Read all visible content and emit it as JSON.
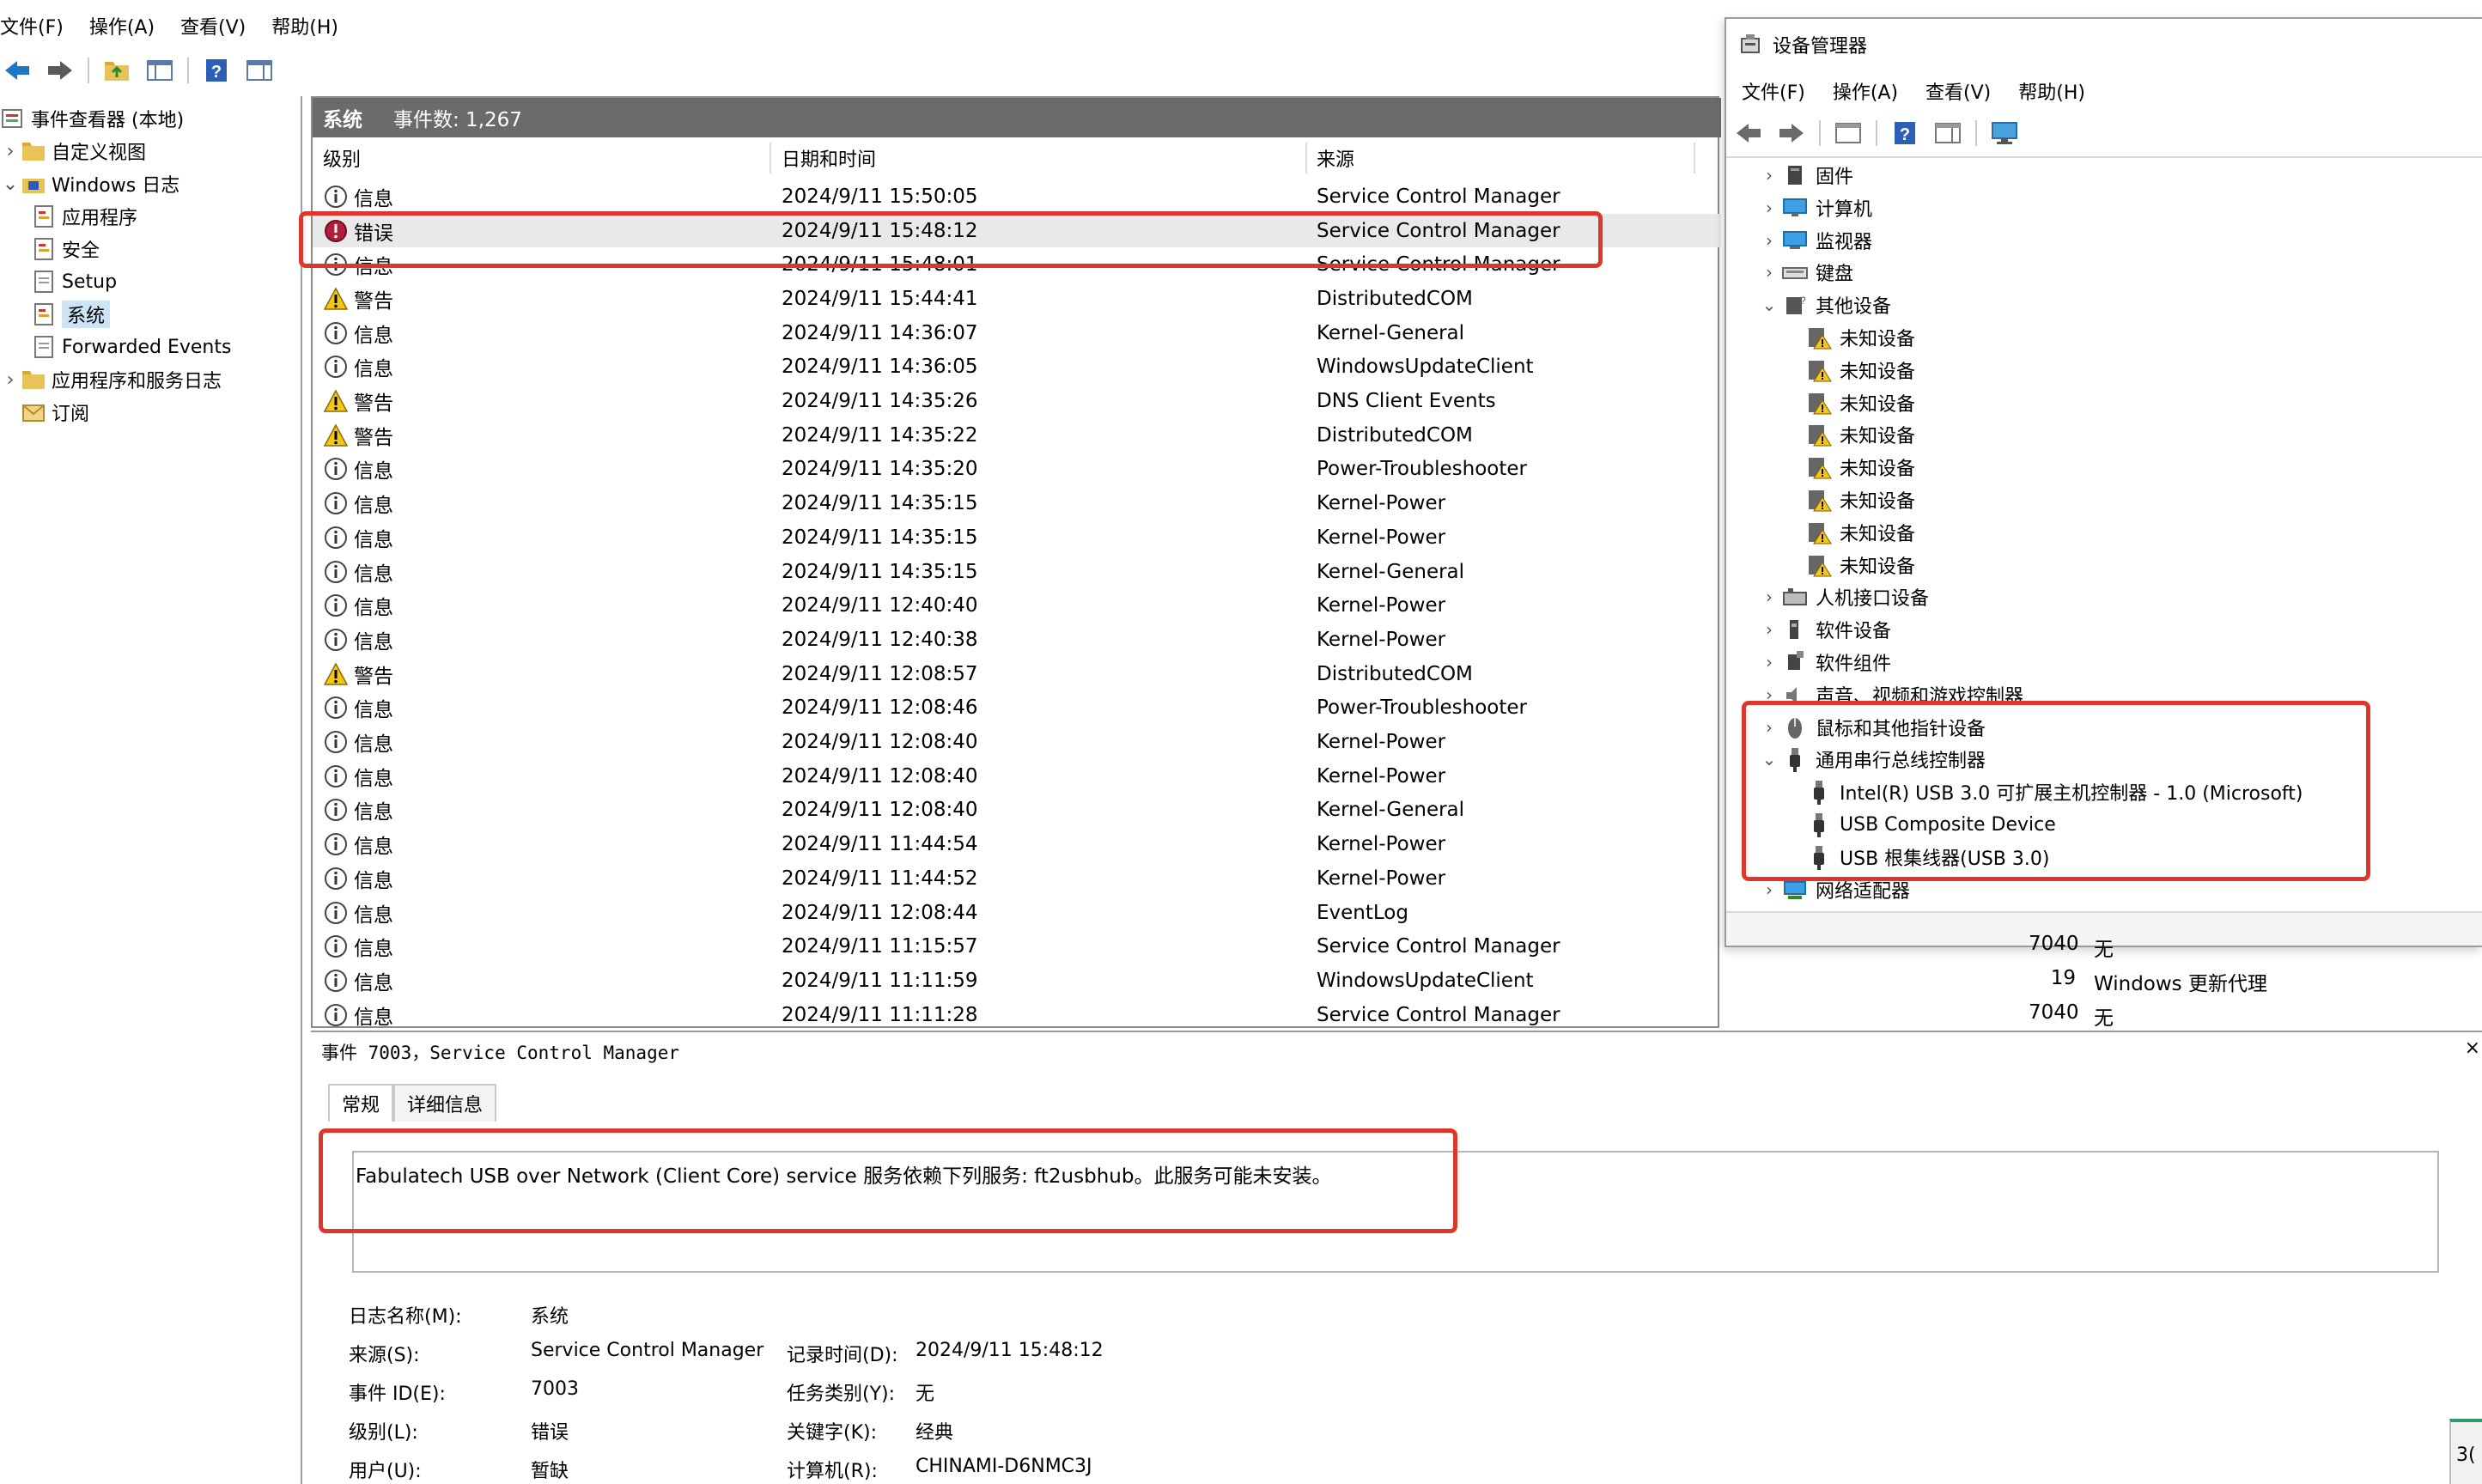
{
  "event_viewer": {
    "menu": [
      "文件(F)",
      "操作(A)",
      "查看(V)",
      "帮助(H)"
    ],
    "tree": {
      "root": "事件查看器 (本地)",
      "custom_views": "自定义视图",
      "windows_logs": "Windows 日志",
      "application": "应用程序",
      "security": "安全",
      "setup": "Setup",
      "system": "系统",
      "forwarded": "Forwarded Events",
      "app_service_logs": "应用程序和服务日志",
      "subscriptions": "订阅"
    },
    "grid": {
      "log_name": "系统",
      "event_count": "事件数: 1,267",
      "columns": [
        "级别",
        "日期和时间",
        "来源"
      ],
      "rows": [
        {
          "level": "信息",
          "type": "info",
          "datetime": "2024/9/11 15:50:05",
          "source": "Service Control Manager"
        },
        {
          "level": "错误",
          "type": "error",
          "datetime": "2024/9/11 15:48:12",
          "source": "Service Control Manager"
        },
        {
          "level": "信息",
          "type": "info",
          "datetime": "2024/9/11 15:48:01",
          "source": "Service Control Manager"
        },
        {
          "level": "警告",
          "type": "warn",
          "datetime": "2024/9/11 15:44:41",
          "source": "DistributedCOM"
        },
        {
          "level": "信息",
          "type": "info",
          "datetime": "2024/9/11 14:36:07",
          "source": "Kernel-General"
        },
        {
          "level": "信息",
          "type": "info",
          "datetime": "2024/9/11 14:36:05",
          "source": "WindowsUpdateClient"
        },
        {
          "level": "警告",
          "type": "warn",
          "datetime": "2024/9/11 14:35:26",
          "source": "DNS Client Events"
        },
        {
          "level": "警告",
          "type": "warn",
          "datetime": "2024/9/11 14:35:22",
          "source": "DistributedCOM"
        },
        {
          "level": "信息",
          "type": "info",
          "datetime": "2024/9/11 14:35:20",
          "source": "Power-Troubleshooter"
        },
        {
          "level": "信息",
          "type": "info",
          "datetime": "2024/9/11 14:35:15",
          "source": "Kernel-Power"
        },
        {
          "level": "信息",
          "type": "info",
          "datetime": "2024/9/11 14:35:15",
          "source": "Kernel-Power"
        },
        {
          "level": "信息",
          "type": "info",
          "datetime": "2024/9/11 14:35:15",
          "source": "Kernel-General"
        },
        {
          "level": "信息",
          "type": "info",
          "datetime": "2024/9/11 12:40:40",
          "source": "Kernel-Power"
        },
        {
          "level": "信息",
          "type": "info",
          "datetime": "2024/9/11 12:40:38",
          "source": "Kernel-Power"
        },
        {
          "level": "警告",
          "type": "warn",
          "datetime": "2024/9/11 12:08:57",
          "source": "DistributedCOM"
        },
        {
          "level": "信息",
          "type": "info",
          "datetime": "2024/9/11 12:08:46",
          "source": "Power-Troubleshooter"
        },
        {
          "level": "信息",
          "type": "info",
          "datetime": "2024/9/11 12:08:40",
          "source": "Kernel-Power"
        },
        {
          "level": "信息",
          "type": "info",
          "datetime": "2024/9/11 12:08:40",
          "source": "Kernel-Power"
        },
        {
          "level": "信息",
          "type": "info",
          "datetime": "2024/9/11 12:08:40",
          "source": "Kernel-General"
        },
        {
          "level": "信息",
          "type": "info",
          "datetime": "2024/9/11 11:44:54",
          "source": "Kernel-Power"
        },
        {
          "level": "信息",
          "type": "info",
          "datetime": "2024/9/11 11:44:52",
          "source": "Kernel-Power"
        },
        {
          "level": "信息",
          "type": "info",
          "datetime": "2024/9/11 12:08:44",
          "source": "EventLog"
        },
        {
          "level": "信息",
          "type": "info",
          "datetime": "2024/9/11 11:15:57",
          "source": "Service Control Manager",
          "id": "7040",
          "task": "无"
        },
        {
          "level": "信息",
          "type": "info",
          "datetime": "2024/9/11 11:11:59",
          "source": "WindowsUpdateClient",
          "id": "19",
          "task": "Windows 更新代理"
        },
        {
          "level": "信息",
          "type": "info",
          "datetime": "2024/9/11 11:11:28",
          "source": "Service Control Manager",
          "id": "7040",
          "task": "无"
        }
      ]
    },
    "detail": {
      "title": "事件 7003，Service Control Manager",
      "tabs": [
        "常规",
        "详细信息"
      ],
      "description": "Fabulatech USB over Network (Client Core) service 服务依赖下列服务: ft2usbhub。此服务可能未安装。",
      "labels": {
        "log_name": "日志名称(M):",
        "source": "来源(S):",
        "event_id": "事件 ID(E):",
        "level": "级别(L):",
        "user": "用户(U):",
        "logged": "记录时间(D):",
        "task": "任务类别(Y):",
        "keywords": "关键字(K):",
        "computer": "计算机(R):"
      },
      "values": {
        "log_name": "系统",
        "source": "Service Control Manager",
        "event_id": "7003",
        "level": "错误",
        "user": "暂缺",
        "logged": "2024/9/11 15:48:12",
        "task": "无",
        "keywords": "经典",
        "computer": "CHINAMI-D6NMC3J"
      }
    }
  },
  "device_manager": {
    "title": "设备管理器",
    "menu": [
      "文件(F)",
      "操作(A)",
      "查看(V)",
      "帮助(H)"
    ],
    "tree": [
      {
        "label": "固件",
        "exp": "›",
        "level": 0,
        "icon": "firmware-icon"
      },
      {
        "label": "计算机",
        "exp": "›",
        "level": 0,
        "icon": "computer-icon"
      },
      {
        "label": "监视器",
        "exp": "›",
        "level": 0,
        "icon": "monitor-icon"
      },
      {
        "label": "键盘",
        "exp": "›",
        "level": 0,
        "icon": "keyboard-icon"
      },
      {
        "label": "其他设备",
        "exp": "⌄",
        "level": 0,
        "icon": "other-devices-icon"
      },
      {
        "label": "未知设备",
        "exp": "",
        "level": 1,
        "icon": "unknown-device-warning-icon"
      },
      {
        "label": "未知设备",
        "exp": "",
        "level": 1,
        "icon": "unknown-device-warning-icon"
      },
      {
        "label": "未知设备",
        "exp": "",
        "level": 1,
        "icon": "unknown-device-warning-icon"
      },
      {
        "label": "未知设备",
        "exp": "",
        "level": 1,
        "icon": "unknown-device-warning-icon"
      },
      {
        "label": "未知设备",
        "exp": "",
        "level": 1,
        "icon": "unknown-device-warning-icon"
      },
      {
        "label": "未知设备",
        "exp": "",
        "level": 1,
        "icon": "unknown-device-warning-icon"
      },
      {
        "label": "未知设备",
        "exp": "",
        "level": 1,
        "icon": "unknown-device-warning-icon"
      },
      {
        "label": "未知设备",
        "exp": "",
        "level": 1,
        "icon": "unknown-device-warning-icon"
      },
      {
        "label": "人机接口设备",
        "exp": "›",
        "level": 0,
        "icon": "hid-icon"
      },
      {
        "label": "软件设备",
        "exp": "›",
        "level": 0,
        "icon": "software-device-icon"
      },
      {
        "label": "软件组件",
        "exp": "›",
        "level": 0,
        "icon": "software-component-icon"
      },
      {
        "label": "声音、视频和游戏控制器",
        "exp": "›",
        "level": 0,
        "icon": "audio-icon"
      },
      {
        "label": "鼠标和其他指针设备",
        "exp": "›",
        "level": 0,
        "icon": "mouse-icon"
      },
      {
        "label": "通用串行总线控制器",
        "exp": "⌄",
        "level": 0,
        "icon": "usb-icon"
      },
      {
        "label": "Intel(R) USB 3.0 可扩展主机控制器 - 1.0 (Microsoft)",
        "exp": "",
        "level": 1,
        "icon": "usb-icon"
      },
      {
        "label": "USB Composite Device",
        "exp": "",
        "level": 1,
        "icon": "usb-icon"
      },
      {
        "label": "USB 根集线器(USB 3.0)",
        "exp": "",
        "level": 1,
        "icon": "usb-icon"
      },
      {
        "label": "网络适配器",
        "exp": "›",
        "level": 0,
        "icon": "network-icon"
      }
    ]
  },
  "corner_fragment": "3("
}
